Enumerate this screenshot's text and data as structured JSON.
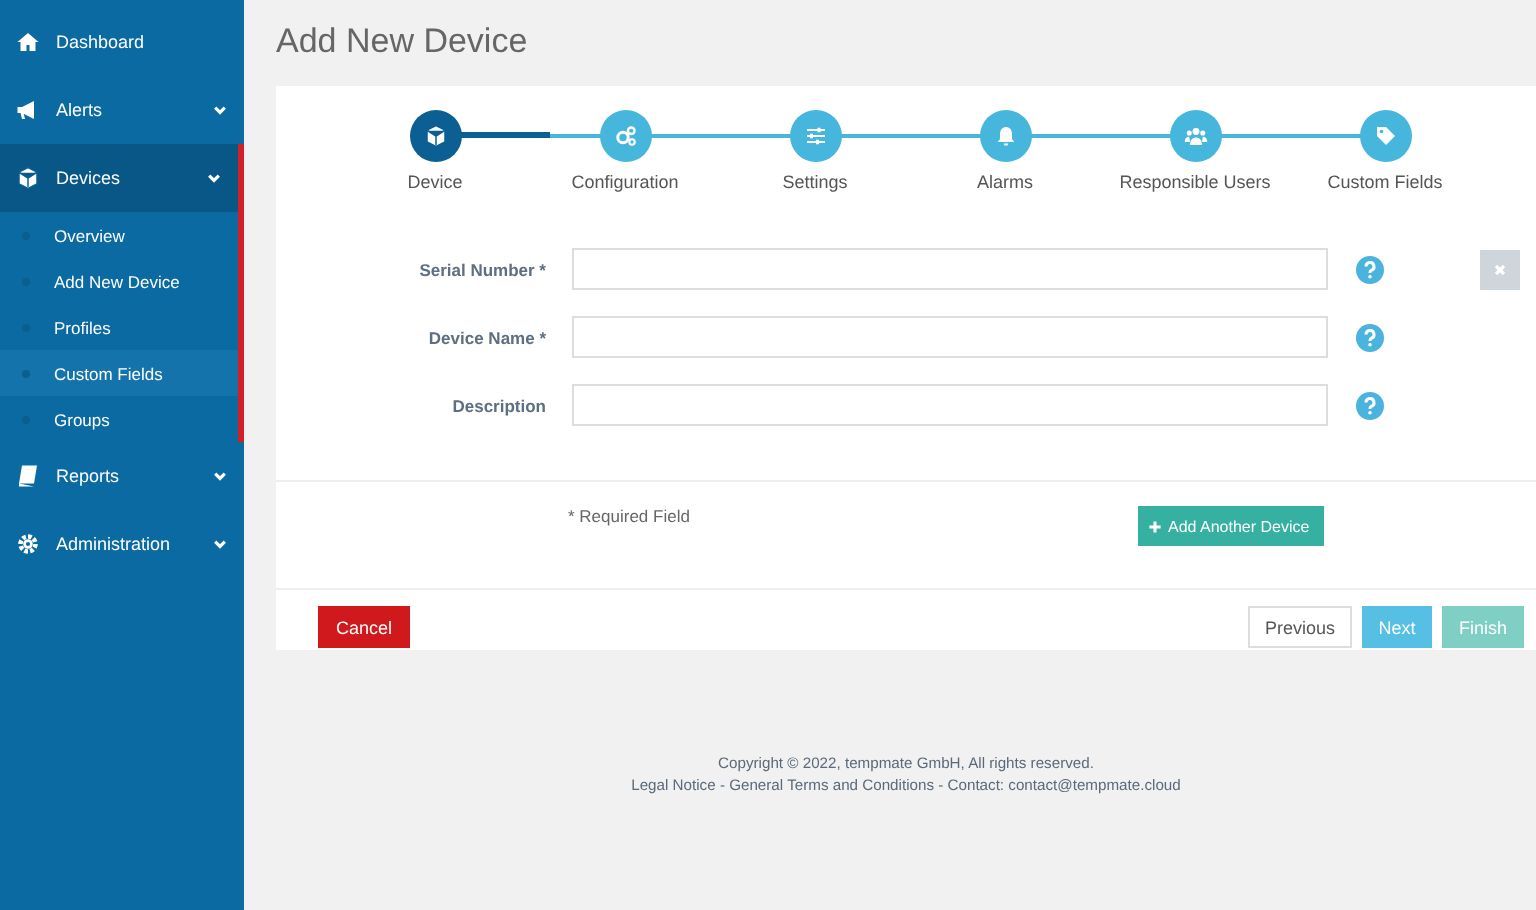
{
  "sidebar": {
    "items": [
      {
        "label": "Dashboard"
      },
      {
        "label": "Alerts",
        "expanded": false
      },
      {
        "label": "Devices",
        "expanded": true,
        "children": [
          {
            "label": "Overview",
            "selected": false
          },
          {
            "label": "Add New Device",
            "selected": false
          },
          {
            "label": "Profiles",
            "selected": false
          },
          {
            "label": "Custom Fields",
            "selected": true
          },
          {
            "label": "Groups",
            "selected": false
          }
        ]
      },
      {
        "label": "Reports",
        "expanded": false
      },
      {
        "label": "Administration",
        "expanded": false
      }
    ]
  },
  "page_title": "Add New Device",
  "steps": [
    {
      "label": "Device",
      "selected": true
    },
    {
      "label": "Configuration",
      "selected": false
    },
    {
      "label": "Settings",
      "selected": false
    },
    {
      "label": "Alarms",
      "selected": false
    },
    {
      "label": "Responsible Users",
      "selected": false
    },
    {
      "label": "Custom Fields",
      "selected": false
    }
  ],
  "fields": [
    {
      "label": "Serial Number *"
    },
    {
      "label": "Device Name *"
    },
    {
      "label": "Description"
    }
  ],
  "required_note": "* Required Field",
  "add_button": "Add Another Device",
  "buttons": {
    "cancel": "Cancel",
    "previous": "Previous",
    "next": "Next",
    "finish": "Finish",
    "finish_disabled": true
  },
  "footer": {
    "copyright": "Copyright © 2022, tempmate GmbH, All rights reserved.",
    "legal": "Legal Notice",
    "sep1": " - ",
    "terms": "General Terms and Conditions",
    "contact_label": " - Contact: ",
    "email": "contact@tempmate.cloud"
  }
}
